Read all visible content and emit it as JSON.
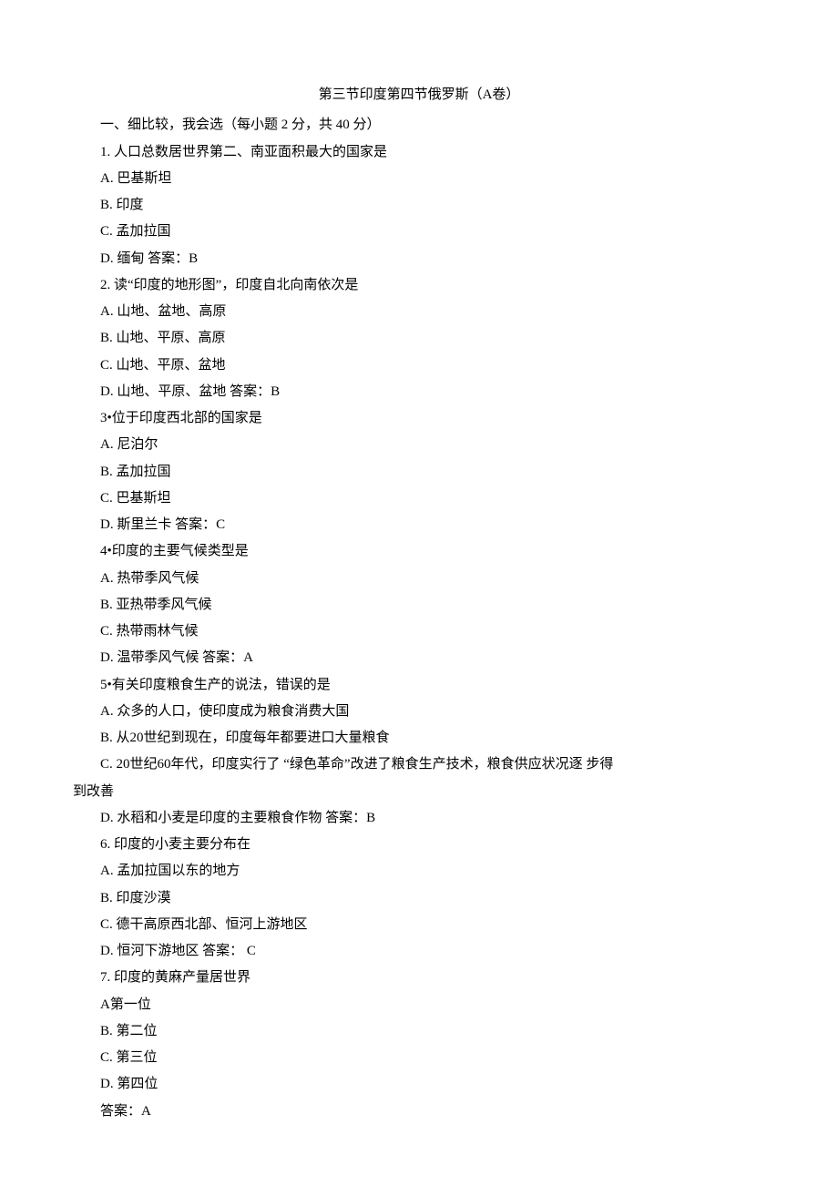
{
  "title": "第三节印度第四节俄罗斯（A卷）",
  "section_header": "一、细比较，我会选（每小题 2 分，共 40 分）",
  "q1": {
    "stem": "1. 人口总数居世界第二、南亚面积最大的国家是",
    "a": "A. 巴基斯坦",
    "b": "B. 印度",
    "c": "C. 孟加拉国",
    "d_ans": "D. 缅甸 答案：B"
  },
  "q2": {
    "stem": "2. 读“印度的地形图”，印度自北向南依次是",
    "a": "A. 山地、盆地、高原",
    "b": "B. 山地、平原、高原",
    "c": "C. 山地、平原、盆地",
    "d_ans": "D. 山地、平原、盆地 答案：B"
  },
  "q3": {
    "stem": "3•位于印度西北部的国家是",
    "a": "A. 尼泊尔",
    "b": "B. 孟加拉国",
    "c": "C. 巴基斯坦",
    "d_ans": "D. 斯里兰卡 答案：C"
  },
  "q4": {
    "stem": "4•印度的主要气候类型是",
    "a": "A. 热带季风气候",
    "b": "B. 亚热带季风气候",
    "c": "C. 热带雨林气候",
    "d_ans": "D. 温带季风气候 答案：A"
  },
  "q5": {
    "stem": "5•有关印度粮食生产的说法，错误的是",
    "a": "A. 众多的人口，使印度成为粮食消费大国",
    "b": "B. 从20世纪到现在，印度每年都要进口大量粮食",
    "c1": "C. 20世纪60年代，印度实行了 “绿色革命”改进了粮食生产技术，粮食供应状况逐 步得",
    "c2": "到改善",
    "d_ans": "D. 水稻和小麦是印度的主要粮食作物 答案：B"
  },
  "q6": {
    "stem": "6. 印度的小麦主要分布在",
    "a": "A. 孟加拉国以东的地方",
    "b": "B. 印度沙漠",
    "c": "C. 德干高原西北部、恒河上游地区",
    "d_ans": "D. 恒河下游地区 答案： C"
  },
  "q7": {
    "stem": "7. 印度的黄麻产量居世界",
    "a": "A第一位",
    "b": "B. 第二位",
    "c": "C. 第三位",
    "d": "D. 第四位",
    "ans": "答案：A"
  }
}
